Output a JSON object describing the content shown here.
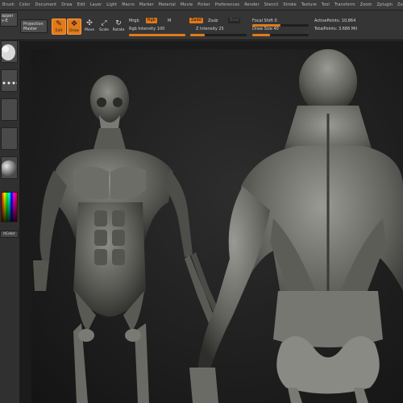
{
  "menu": {
    "items": [
      "Brush",
      "Color",
      "Document",
      "Draw",
      "Edit",
      "Layer",
      "Light",
      "Macro",
      "Marker",
      "Material",
      "Movie",
      "Picker",
      "Preferences",
      "Render",
      "Stencil",
      "Stroke",
      "Texture",
      "Tool",
      "Transform",
      "Zoom",
      "Zplugin",
      "Zscript"
    ]
  },
  "left_tray": {
    "top_tile_label": "apper\nv-E",
    "switch_color_label": "hColor"
  },
  "shelf": {
    "projection_master_label": "Projection\nMaster",
    "edit_label": "Edit",
    "draw_label": "Draw",
    "move_label": "Move",
    "scale_label": "Scale",
    "rotate_label": "Rotate",
    "mrgb_label": "Mrgb",
    "rgb_label": "Rgb",
    "m_label": "M",
    "zadd_label": "Zadd",
    "zsub_label": "Zsub",
    "zcut_label": "Zcut",
    "rgb_intensity_label": "Rgb Intensity 100",
    "z_intensity_label": "Z Intensity 25",
    "focal_shift_label": "Focal Shift 0",
    "draw_size_label": "Draw Size 40",
    "active_points_label": "ActivePoints: 10,864",
    "total_points_label": "TotalPoints: 3.686 Mil",
    "rgb_intensity_value": 100,
    "z_intensity_value": 25,
    "focal_shift_value": 0,
    "draw_size_value": 40
  },
  "colors": {
    "accent": "#e07a1b",
    "background": "#2a2a2a",
    "canvas": "#1b1b1b"
  }
}
